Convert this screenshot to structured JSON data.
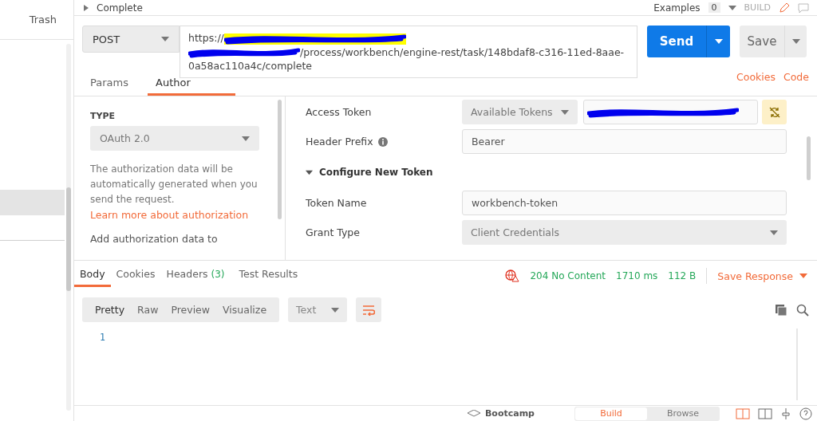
{
  "sidebar": {
    "trash_label": "Trash",
    "items": [
      {
        "selected": true
      },
      {
        "selected": false
      }
    ]
  },
  "header": {
    "request_name": "Complete",
    "examples_label": "Examples",
    "examples_count": "0",
    "build_label": "BUILD"
  },
  "request": {
    "method": "POST",
    "url_prefix": "https://",
    "url_path": "/process/workbench/engine-rest/task/148bdaf8-c316-11ed-8aae-0a58ac110a4c/complete",
    "send_label": "Send",
    "save_label": "Save",
    "tabs": [
      {
        "label": "Params",
        "selected": false
      },
      {
        "label": "Author",
        "selected": true
      }
    ],
    "links": [
      "Cookies",
      "Code"
    ]
  },
  "auth": {
    "type_heading": "TYPE",
    "type_value": "OAuth 2.0",
    "description": "The authorization data will be automatically generated when you send the request. ",
    "learn_more": "Learn more about authorization",
    "add_to_label": "Add authorization data to",
    "fields": [
      {
        "kind": "token",
        "label": "Access Token",
        "select": "Available Tokens"
      },
      {
        "kind": "text",
        "label": "Header Prefix",
        "value": "Bearer",
        "info": true
      },
      {
        "kind": "section",
        "label": "Configure New Token",
        "expanded": true
      },
      {
        "kind": "text",
        "label": "Token Name",
        "value": "workbench-token",
        "info": false
      },
      {
        "kind": "select",
        "label": "Grant Type",
        "value": "Client Credentials"
      }
    ]
  },
  "response": {
    "tabs": [
      {
        "label": "Body",
        "selected": true
      },
      {
        "label": "Cookies",
        "selected": false
      },
      {
        "label": "Headers",
        "count": "(3)",
        "selected": false
      },
      {
        "label": "Test Results",
        "selected": false
      }
    ],
    "status": "204 No Content",
    "time": "1710 ms",
    "size": "112 B",
    "save_label": "Save Response",
    "formats": [
      {
        "label": "Pretty",
        "selected": true
      },
      {
        "label": "Raw",
        "selected": false
      },
      {
        "label": "Preview",
        "selected": false
      },
      {
        "label": "Visualize",
        "selected": false
      }
    ],
    "language": "Text",
    "line_numbers": [
      "1"
    ]
  },
  "status_bar": {
    "bootcamp_label": "Bootcamp",
    "modes": [
      {
        "label": "Build",
        "selected": true
      },
      {
        "label": "Browse",
        "selected": false
      }
    ]
  }
}
